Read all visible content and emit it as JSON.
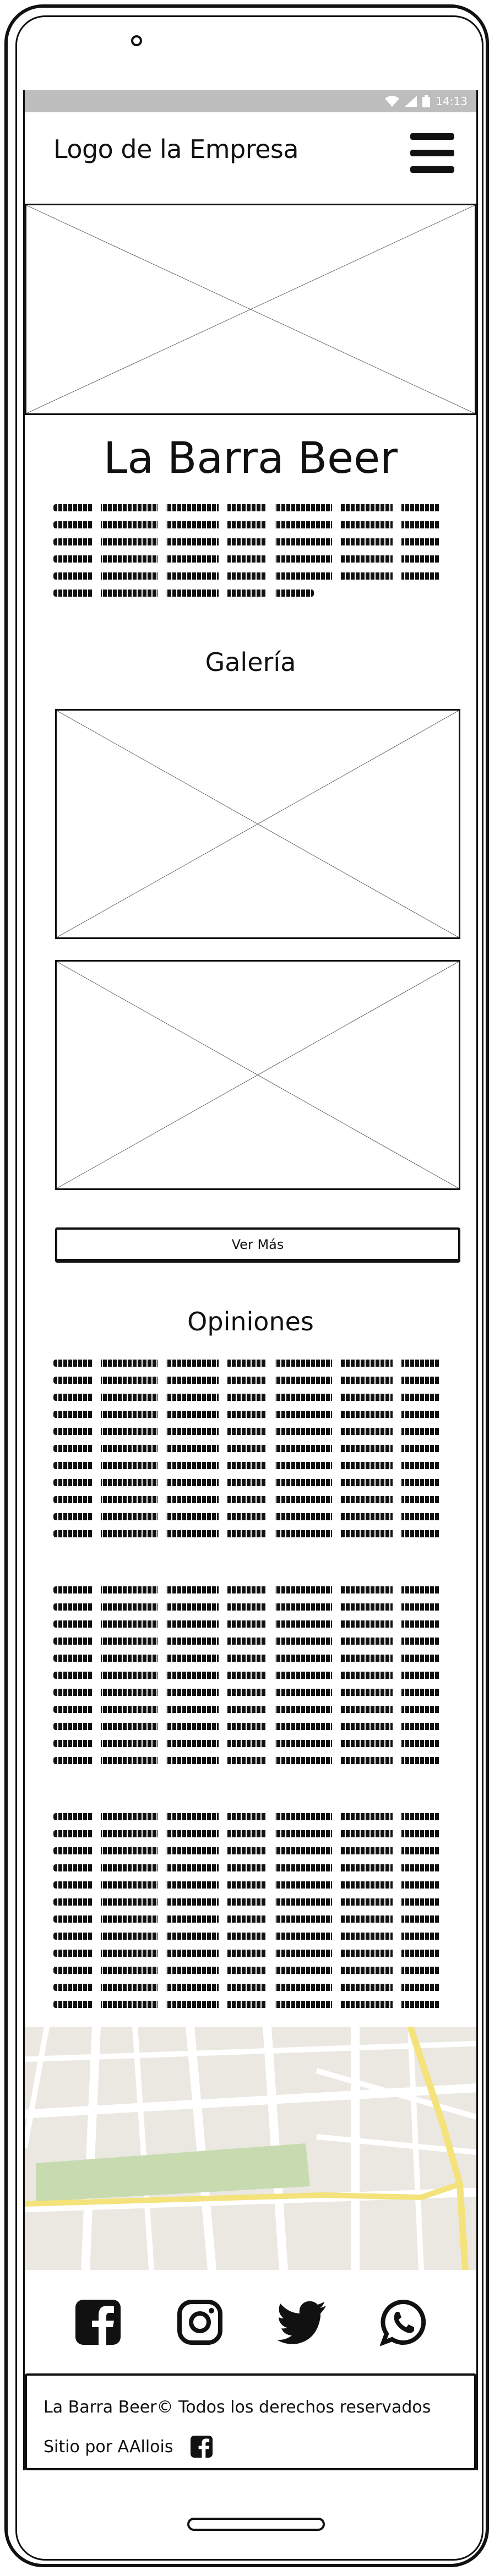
{
  "status_bar": {
    "time": "14:13"
  },
  "header": {
    "logo": "Logo de la Empresa"
  },
  "main": {
    "title": "La Barra Beer"
  },
  "gallery": {
    "title": "Galería",
    "more_label": "Ver Más"
  },
  "reviews": {
    "title": "Opiniones"
  },
  "social": {
    "icons": [
      "facebook-icon",
      "instagram-icon",
      "twitter-icon",
      "whatsapp-icon"
    ]
  },
  "footer": {
    "copyright": "La Barra Beer© Todos los derechos reservados",
    "credit": "Sitio por AAllois"
  },
  "colors": {
    "status_bar": "#bdbdbd",
    "map_land": "#ebe8e2",
    "map_park": "#c8dbb0",
    "map_highway": "#f4e27a"
  }
}
